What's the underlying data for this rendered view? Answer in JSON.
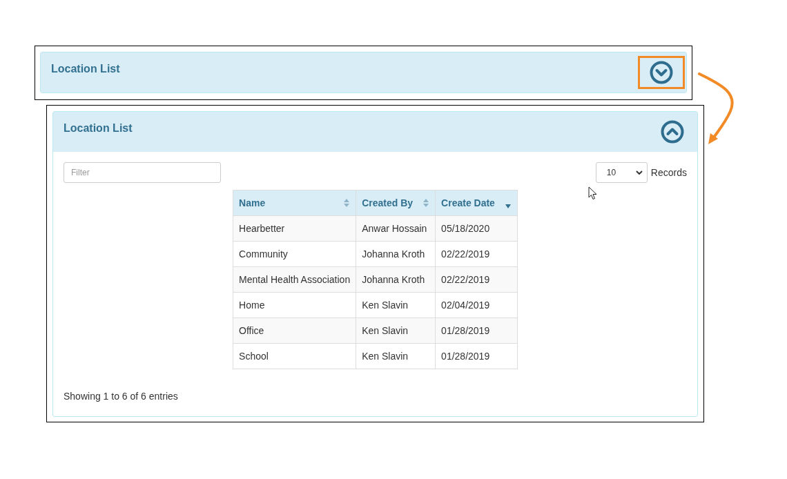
{
  "panels": [
    {
      "title": "Location List",
      "expanded": false,
      "highlighted": true
    },
    {
      "title": "Location List",
      "expanded": true,
      "highlighted": false,
      "filter": {
        "placeholder": "Filter"
      },
      "page_size": {
        "value": "10",
        "label": "Records"
      },
      "table": {
        "columns": [
          {
            "label": "Name",
            "kind": "sortable"
          },
          {
            "label": "Created By",
            "kind": "sortable"
          },
          {
            "label": "Create Date",
            "kind": "sorted_desc"
          }
        ],
        "rows": [
          [
            "Hearbetter",
            "Anwar Hossain",
            "05/18/2020"
          ],
          [
            "Community",
            "Johanna Kroth",
            "02/22/2019"
          ],
          [
            "Mental Health Association",
            "Johanna Kroth",
            "02/22/2019"
          ],
          [
            "Home",
            "Ken Slavin",
            "02/04/2019"
          ],
          [
            "Office",
            "Ken Slavin",
            "01/28/2019"
          ],
          [
            "School",
            "Ken Slavin",
            "01/28/2019"
          ]
        ]
      },
      "footer": "Showing 1 to 6 of 6 entries"
    }
  ]
}
